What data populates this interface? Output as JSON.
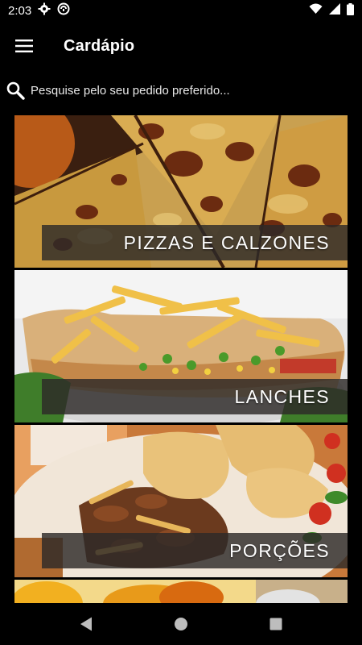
{
  "status_bar": {
    "time": "2:03",
    "icons": [
      "gear-icon",
      "sync-icon",
      "wifi-icon",
      "signal-icon",
      "battery-icon"
    ]
  },
  "app_bar": {
    "title": "Cardápio",
    "menu_icon": "hamburger-menu-icon"
  },
  "search": {
    "icon": "search-icon",
    "text": "Pesquise pelo seu pedido preferido..."
  },
  "categories": [
    {
      "label": "PIZZAS E CALZONES",
      "image": "pizza-photo"
    },
    {
      "label": "LANCHES",
      "image": "sandwich-fries-photo"
    },
    {
      "label": "PORÇÕES",
      "image": "meat-fries-portion-photo"
    },
    {
      "label": "",
      "image": "dessert-photo"
    }
  ],
  "nav_bar": {
    "back": "back-triangle-icon",
    "home": "home-circle-icon",
    "recents": "recents-square-icon"
  },
  "colors": {
    "background": "#000000",
    "label_overlay": "#2d2a28",
    "text": "#ffffff"
  }
}
